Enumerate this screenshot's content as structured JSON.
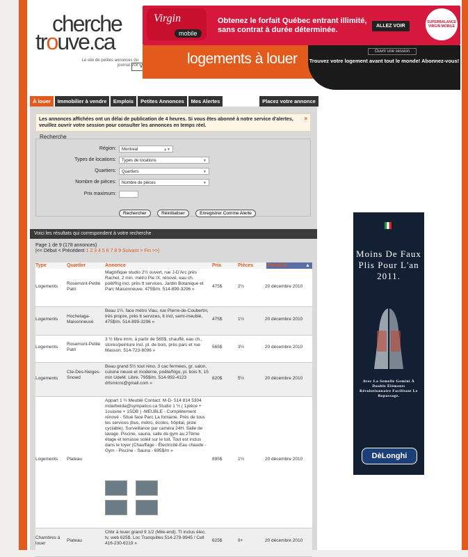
{
  "logo": {
    "line1": "cherche",
    "line2a": "tr",
    "line2b": "o",
    "line2c": "uve.ca",
    "tagline": "Le site de petites annonces du journal Voir",
    "voir": "VOIR"
  },
  "banner": {
    "brand1": "Virgin",
    "brand2": "mobile",
    "headline": "Obtenez le forfait Québec entrant illimité, sans contrat à durée déterminée.",
    "cta": "ALLEZ VOIR",
    "sticker": "SUPERBALANCE VIRGIN MOBILE"
  },
  "section_title": "logements à louer",
  "session": {
    "open_label": "Ouvrir une session",
    "message": "Trouvez votre logement avant tout le monde! Abonnez-vous!"
  },
  "nav": {
    "tabs": [
      "À louer",
      "Immobilier à vendre",
      "Emplois",
      "Petites Annonces",
      "Mes Alertes"
    ],
    "post": "Placez votre annonce"
  },
  "notice": {
    "text": "Les annonces affichées ont un délai de publication de 4 heures. Si vous êtes abonné à notre service d'alertes, veuillez ouvrir votre session pour consulter les annonces en temps réel.",
    "close": "×"
  },
  "search": {
    "legend": "Recherche",
    "region_label": "Région:",
    "region_value": "Montreal",
    "types_label": "Types de locations:",
    "types_value": "Types de locations",
    "quartiers_label": "Quartiers:",
    "quartiers_value": "Quartiers",
    "pieces_label": "Nombre de pièces:",
    "pieces_value": "Nombre de pièces",
    "prix_label": "Prix maximum:",
    "prix_value": "",
    "btn_search": "Rechercher",
    "btn_reset": "Réinitialiser",
    "btn_alert": "Enregistrer Comme Alerte"
  },
  "results": {
    "bar": "Voici les résultats qui correspondent à votre recherche",
    "page_info": "Page 1 de 9 (178 annonces)",
    "debut": "|<< Début",
    "precedent": "< Précédent",
    "pages": "1 2 3 4 5 6 7 8 9",
    "suivant": "Suivant >",
    "fin": "Fin >>|"
  },
  "table": {
    "headers": [
      "Type",
      "Quartier",
      "Annonce",
      "Prix",
      "Pièces",
      "Parution"
    ],
    "sort_arrow": "▲",
    "rows": [
      {
        "type": "Logements",
        "quartier": "Rosemont-Petite Patri",
        "annonce": "Magnifique studio 2½ ouvert, rue J-D'Arc près Rachel, 2 min. métro Pie IX, rénové, eau ch. poêl/frig incl. près tt services, Jardin Botanique et Parc Maisonneuve. 475$/m. 514-899-3296 »",
        "prix": "475$",
        "pieces": "2½",
        "parution": "20 décembre 2010"
      },
      {
        "type": "Logements",
        "quartier": "Hochelaga-Maisonneuve",
        "annonce": "Beau 1½, face métro Viau, rue Pierre-de-Coubertin, très propre, près tt services, tt incl, semi-meublé, 475$/m. 514-899-3296 »",
        "prix": "475$",
        "pieces": "1½",
        "parution": "20 décembre 2010"
      },
      {
        "type": "Logements",
        "quartier": "Rosemont-Petite Patri",
        "annonce": "3 ½ libre imm, à partir de 565$, chauffé, eau ch., stores/peinture incl. pl. de bois, près parc et rue Masson. 514-723-8096 »",
        "prix": "565$",
        "pieces": "3½",
        "parution": "20 décembre 2010"
      },
      {
        "type": "Logements",
        "quartier": "Cte-Des-Neiges-Snowd",
        "annonce": "Beau grand 5½ tout réno, 3 cac fermées, gr. salon, cuisine neuve et moderne, poêle/frigo, pl. bois fr, 15 min UdeM. Libre. 795$/m. 514-992-4123 drlsmicro@gmail.com »",
        "prix": "820$",
        "pieces": "5½",
        "parution": "20 décembre 2010"
      },
      {
        "type": "Logements",
        "quartier": "Plateau",
        "annonce": "Appart 1 ½ Meublé Contact: M-D- 514 814 5304 mdarbeida@sympatico.ca Studio 1 ½ ( 1pièce + 1cuisine + 1SDB ) -MEUBLE - Complètement rénové - Situé face Parc La fontaine. Près de tous les services (bus, métro, écoles, hôpital, piste cyclable). Surveillance par caméra 24H. Salle de lavage. Piscine, sauna, salle de gym au 27ème étage et terrasse soleil sur le toit. Tout est inclus dans le loyer (Chauffage - Électricité-Eau chaude - Gym - Piscine - Sauna - 695$/m »",
        "prix": "895$",
        "pieces": "1½",
        "parution": "20 décembre 2010"
      },
      {
        "type": "Chambres à louer",
        "quartier": "Plateau",
        "annonce": "Chbr à louer grand 9 1/2 (Mile-end). Tt inclus élec, tv, web 625$. Loc Tranquilles 514-279-9945 / Cell 416-230-6219 »",
        "prix": "625$",
        "pieces": "9+",
        "parution": "20 décembre 2010"
      }
    ]
  },
  "side_ad": {
    "headline": "Moins De Faux Plis Pour L'an 2011.",
    "subtext": "Avec La Semelle Gemini À Double Éléments Révolutionnaire Facilitant Le Repassage.",
    "brand": "DèLonghi"
  },
  "colors": {
    "accent": "#e25a1c",
    "dark": "#333333",
    "virgin": "#d6183d",
    "ad_bg": "#132033"
  }
}
